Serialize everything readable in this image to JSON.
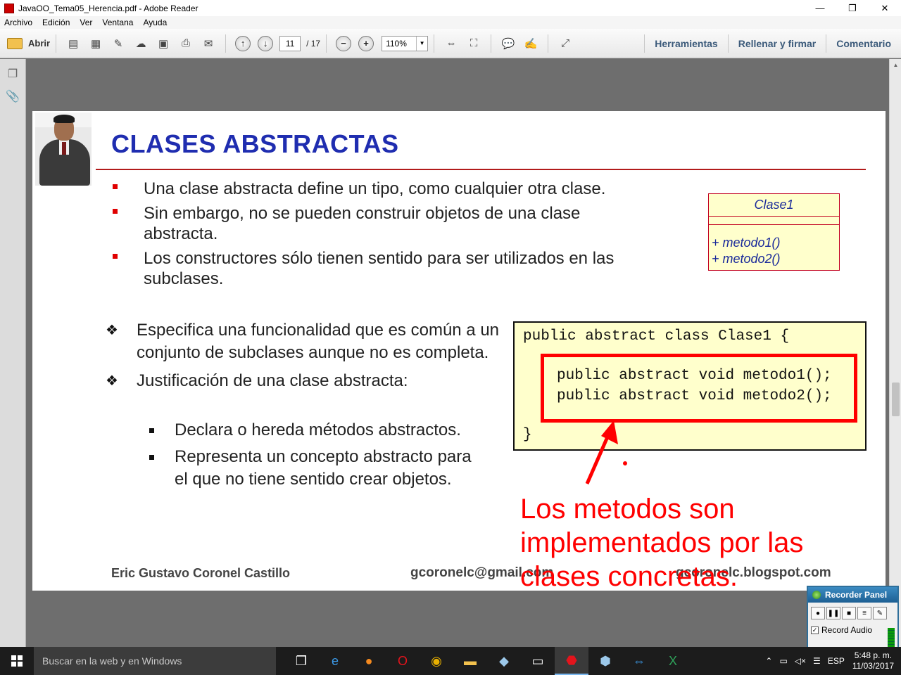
{
  "window": {
    "title": "JavaOO_Tema05_Herencia.pdf - Adobe Reader",
    "controls": [
      "—",
      "❐",
      "✕"
    ]
  },
  "menu": [
    "Archivo",
    "Edición",
    "Ver",
    "Ventana",
    "Ayuda"
  ],
  "toolbar": {
    "open_label": "Abrir",
    "page_current": "11",
    "page_total": "/ 17",
    "zoom": "110%",
    "zoom_out": "−",
    "zoom_in": "+",
    "prev_page": "↑",
    "next_page": "↓",
    "right_links": [
      "Herramientas",
      "Rellenar y firmar",
      "Comentario"
    ]
  },
  "slide": {
    "title": "CLASES ABSTRACTAS",
    "bullets": [
      "Una clase abstracta define un tipo, como cualquier otra clase.",
      "Sin embargo, no se pueden construir objetos de una clase abstracta.",
      "Los constructores sólo tienen sentido para ser utilizados en las subclases."
    ],
    "diamond_marker": "❖",
    "diamond_points": [
      "Especifica una funcionalidad que es común a un conjunto de subclases aunque no es completa.",
      "Justificación de una clase abstracta:"
    ],
    "sub_points": [
      "Declara o hereda métodos abstractos.",
      "Representa un concepto abstracto para el que no tiene sentido crear objetos."
    ],
    "uml": {
      "class_name": "Clase1",
      "operations": [
        "+ metodo1()",
        "+ metodo2()"
      ]
    },
    "code": {
      "line1": "public abstract class Clase1 {",
      "line2": "public abstract void metodo1();",
      "line3": "public abstract void metodo2();",
      "line4": "}"
    },
    "footer": {
      "author": "Eric Gustavo Coronel Castillo",
      "email": "gcoronelc@gmail.com",
      "blog": "gcoronelc.blogspot.com"
    }
  },
  "annotation": {
    "text_line1": "Los metodos son",
    "text_line2": "implementados por las",
    "text_line3": "clases concretas.",
    "color": "#ff0000"
  },
  "recorder": {
    "title": "Recorder Panel",
    "record_audio_label": "Record Audio"
  },
  "taskbar": {
    "search_placeholder": "Buscar en la web y en Windows",
    "language": "ESP",
    "time": "5:48 p. m.",
    "date": "11/03/2017"
  }
}
